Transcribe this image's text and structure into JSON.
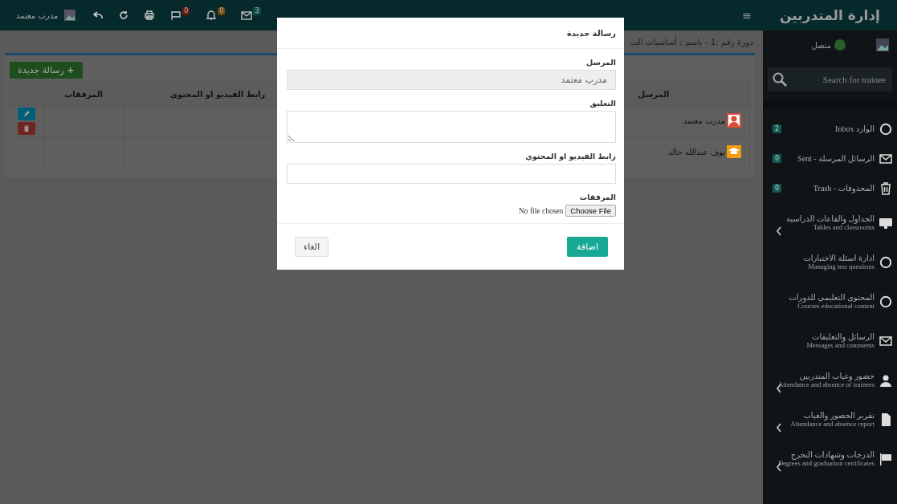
{
  "header": {
    "brand": "إدارة المتدربين",
    "menu_glyph": "≡",
    "user": "مدرب معتمد",
    "notifications": [
      {
        "count": "3",
        "color": "#0d4e46"
      },
      {
        "count": "0",
        "color": "#704706"
      },
      {
        "count": "0",
        "color": "#6a1c12"
      }
    ]
  },
  "sidebar": {
    "status": "متصل",
    "search": {
      "placeholder": "Search for trainee"
    },
    "items": [
      {
        "kind": "mailbox",
        "title": "الوارد Inbox",
        "badge": "2"
      },
      {
        "kind": "mailbox",
        "title": "الرسائل المرسلة - Sent",
        "badge": "0"
      },
      {
        "kind": "mailbox",
        "title": "المحذوفات - Trash",
        "badge": "0"
      },
      {
        "kind": "section",
        "title": "الجداول والقاعات الدراسية",
        "subtitle": "Tables and classrooms",
        "expandable": true
      },
      {
        "kind": "section",
        "title": "ادارة اسئلة الاختبارات",
        "subtitle": "Managing test questions",
        "expandable": false
      },
      {
        "kind": "section",
        "title": "المحتوى التعليمي للدورات",
        "subtitle": "Courses educational content",
        "expandable": false
      },
      {
        "kind": "section",
        "title": "الرسائل والتعليقات",
        "subtitle": "Messages and comments",
        "expandable": false
      },
      {
        "kind": "section",
        "title": "حضور وغياب المتدربين",
        "subtitle": "Attendance and absence of trainees",
        "expandable": true
      },
      {
        "kind": "section",
        "title": "تقرير الحصور والغياب",
        "subtitle": "Attendance and absence report",
        "expandable": true
      },
      {
        "kind": "section",
        "title": "الدرجات وشهادات التخرج",
        "subtitle": "Degrees and graduation certificates",
        "expandable": true
      }
    ]
  },
  "page": {
    "title": "دورة رقم :1 - باسم : أساسيات الت",
    "new_button": "رسالة جديدة",
    "new_button_glyph": "+",
    "table": {
      "columns": [
        "المرسل",
        "",
        "رابط الفيديو او المحتوي",
        "المرفقات",
        ""
      ],
      "rows": [
        {
          "kind": "trainer",
          "sender": "مدرب معتمد",
          "editable": true
        },
        {
          "kind": "trainee",
          "sender": "نوف عبدالله خالد",
          "editable": false
        }
      ]
    }
  },
  "modal": {
    "title": "رسالة جديدة",
    "sender_label": "المرسل",
    "sender_value": "مدرب معتمد",
    "comment_label": "التعليق",
    "link_label": "رابط الفيديو او المحتوي",
    "attachments_label": "المرفقات",
    "file_status": "No file chosen",
    "file_button": "Choose File",
    "submit": "اضافة",
    "cancel": "الغاء"
  }
}
